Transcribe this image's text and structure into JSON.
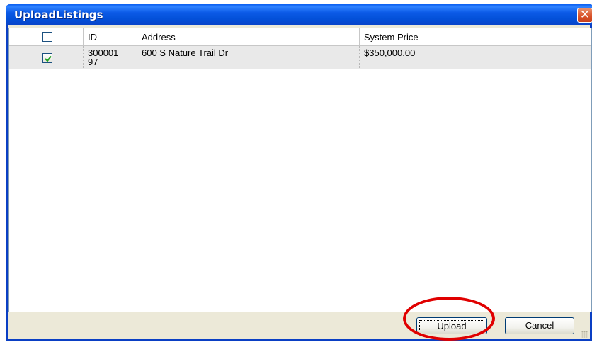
{
  "window": {
    "title": "UploadListings",
    "close_glyph": "✕"
  },
  "grid": {
    "columns": {
      "select": "",
      "id": "ID",
      "address": "Address",
      "system_price": "System Price"
    },
    "header_checkbox_checked": false,
    "rows": [
      {
        "checked": true,
        "id": "30000197",
        "address": "600 S Nature Trail Dr",
        "system_price": "$350,000.00"
      }
    ]
  },
  "buttons": {
    "upload_label": "Upload",
    "cancel_label": "Cancel"
  },
  "colors": {
    "title_bar": "#0a5ef0",
    "window_border": "#0a3fc4",
    "highlight_ring": "#e00000",
    "checkmark": "#21a121"
  }
}
